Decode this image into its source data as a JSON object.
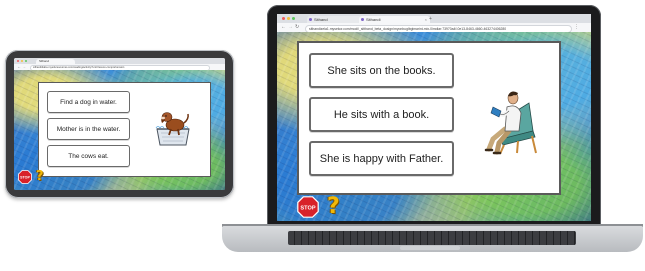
{
  "tablet": {
    "browser": {
      "tab_label": "Silhand",
      "url": "silhandidaba.myeduresources.com/reading/activity?unit=lesson-comprehension"
    },
    "answers": [
      {
        "label": "Find a dog in water."
      },
      {
        "label": "Mother is in the water."
      },
      {
        "label": "The cows eat."
      }
    ],
    "picture_icon": "dog-in-tub-picture",
    "stop_label": "STOP",
    "help_label": "?"
  },
  "laptop": {
    "browser": {
      "tabs": [
        {
          "label": "Sithand"
        },
        {
          "label": "Sithandi"
        }
      ],
      "url": "sithandizela1.mysekor.com/modi/_sitthand_beta_dusign/myonbuglbglmarint-mix-0imdiar:73970a4f-0e13-8463-4660-463274406280"
    },
    "answers": [
      {
        "label": "She sits on the books."
      },
      {
        "label": "He sits with a book."
      },
      {
        "label": "She is happy with Father."
      }
    ],
    "picture_icon": "man-reading-in-chair-picture",
    "stop_label": "STOP",
    "help_label": "?"
  },
  "colors": {
    "stop_red": "#d8222a",
    "help_yellow": "#f2b807",
    "card_border": "#5a5a5a"
  }
}
